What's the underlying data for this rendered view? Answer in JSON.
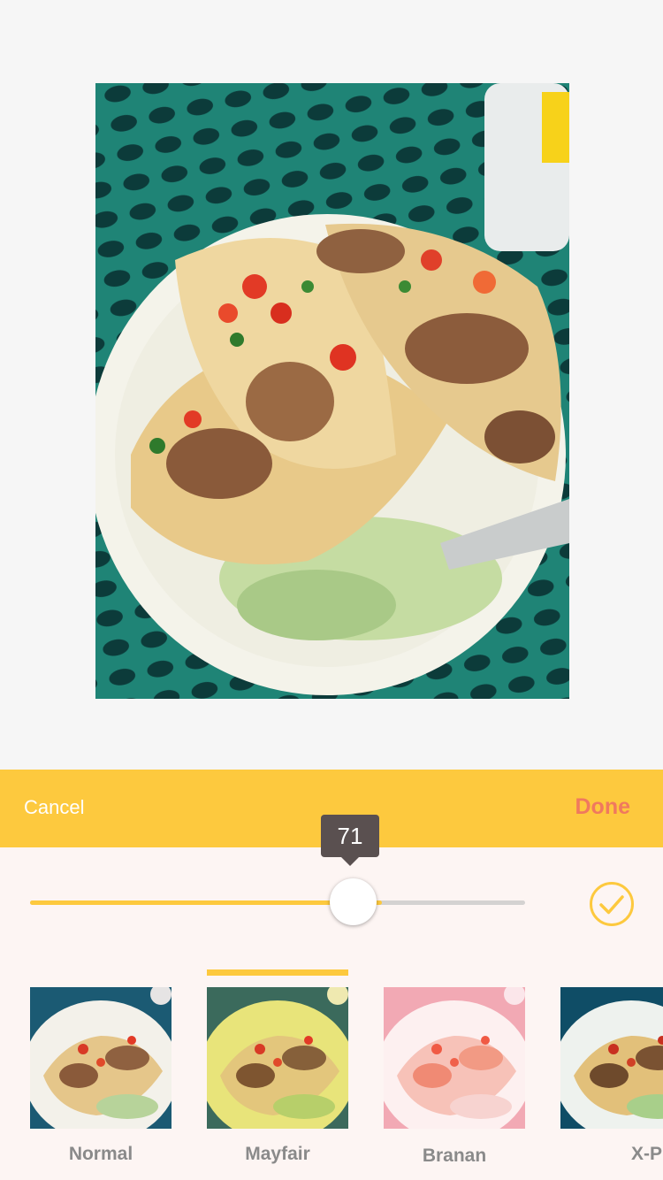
{
  "action_bar": {
    "cancel_label": "Cancel",
    "done_label": "Done"
  },
  "slider": {
    "value_text": "71",
    "value_fraction": 0.71
  },
  "filters": [
    {
      "label": "Normal",
      "selected": false
    },
    {
      "label": "Mayfair",
      "selected": true
    },
    {
      "label": "Branan",
      "selected": false
    },
    {
      "label": "X-Pro",
      "selected": false
    }
  ],
  "colors": {
    "accent": "#fdc93e",
    "done": "#f0795e",
    "panel_bg": "#fdf5f3"
  },
  "icons": {
    "confirm": "check-circle-icon"
  }
}
